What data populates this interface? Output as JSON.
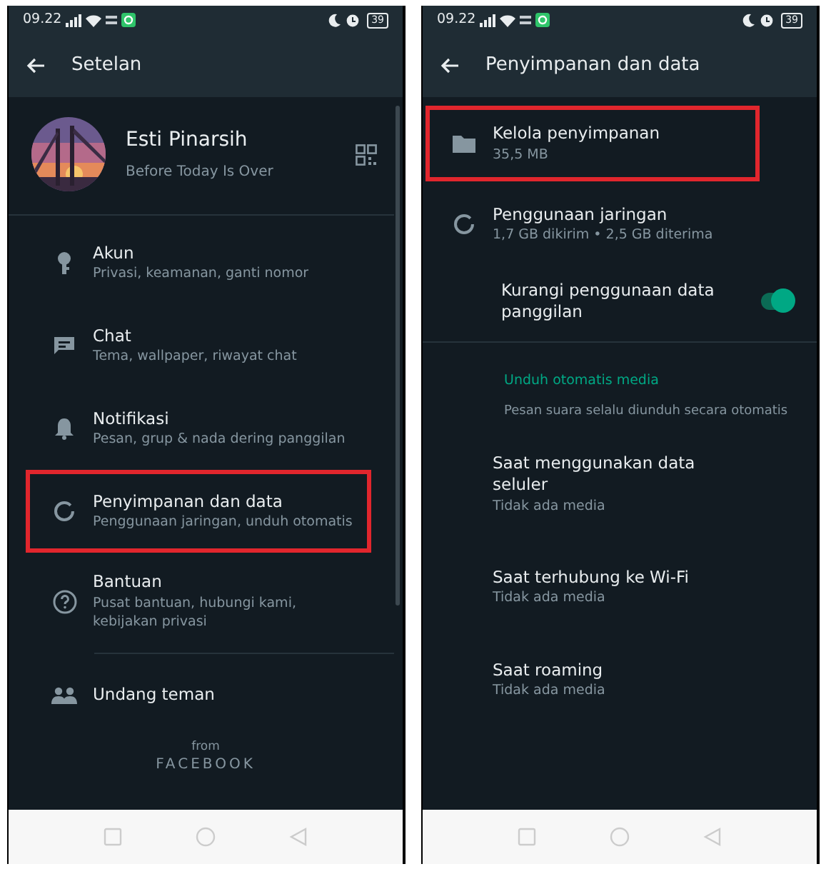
{
  "settings_screen": {
    "status_bar": {
      "time": "09.22",
      "battery": "39"
    },
    "title": "Setelan",
    "profile": {
      "name": "Esti Pinarsih",
      "about": "Before Today Is Over"
    },
    "items": [
      {
        "title": "Akun",
        "subtitle": "Privasi, keamanan, ganti nomor",
        "highlighted": false
      },
      {
        "title": "Chat",
        "subtitle": "Tema, wallpaper, riwayat chat",
        "highlighted": false
      },
      {
        "title": "Notifikasi",
        "subtitle": "Pesan, grup & nada dering panggilan",
        "highlighted": false
      },
      {
        "title": "Penyimpanan dan data",
        "subtitle": "Penggunaan jaringan, unduh otomatis",
        "highlighted": true
      },
      {
        "title": "Bantuan",
        "subtitle": "Pusat bantuan, hubungi kami, kebijakan privasi",
        "highlighted": false
      },
      {
        "title": "Undang teman",
        "highlighted": false
      }
    ],
    "footer": {
      "from": "from",
      "brand": "FACEBOOK"
    }
  },
  "storage_screen": {
    "status_bar": {
      "time": "09.22",
      "battery": "39"
    },
    "title": "Penyimpanan dan data",
    "items": [
      {
        "kind": "row",
        "title": "Kelola penyimpanan",
        "subtitle": "35,5 MB",
        "highlighted": true
      },
      {
        "kind": "row",
        "title": "Penggunaan jaringan",
        "subtitle": "1,7 GB dikirim • 2,5 GB diterima",
        "highlighted": false
      },
      {
        "kind": "toggle",
        "title": "Kurangi penggunaan data panggilan",
        "on": true
      },
      {
        "kind": "section",
        "title": "Unduh otomatis media"
      },
      {
        "kind": "note",
        "title": "Pesan suara selalu diunduh secara otomatis"
      },
      {
        "kind": "row",
        "title": "Saat menggunakan data seluler",
        "subtitle": "Tidak ada media",
        "highlighted": false
      },
      {
        "kind": "row",
        "title": "Saat terhubung ke Wi-Fi",
        "subtitle": "Tidak ada media",
        "highlighted": false
      },
      {
        "kind": "row",
        "title": "Saat roaming",
        "subtitle": "Tidak ada media",
        "highlighted": false
      }
    ]
  }
}
